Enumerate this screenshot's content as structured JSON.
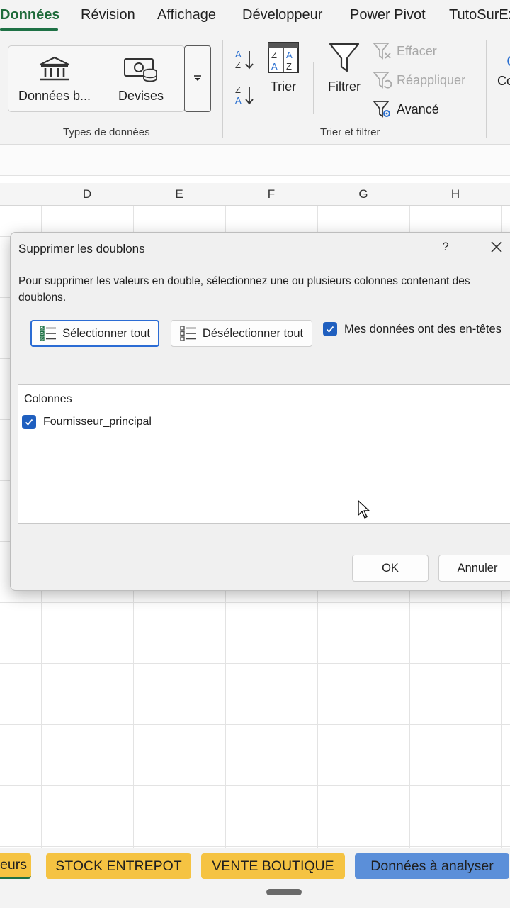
{
  "menu": {
    "tabs": [
      "Données",
      "Révision",
      "Affichage",
      "Développeur",
      "Power Pivot",
      "TutoSurExcel"
    ]
  },
  "ribbon": {
    "data_types": {
      "bank_label": "Données b...",
      "currency_label": "Devises",
      "group_label": "Types de données"
    },
    "sort_filter": {
      "sort_label": "Trier",
      "filter_label": "Filtrer",
      "clear_label": "Effacer",
      "reapply_label": "Réappliquer",
      "advanced_label": "Avancé",
      "group_label": "Trier et filtrer"
    },
    "cut_label": "Co"
  },
  "sheet": {
    "columns": [
      "D",
      "E",
      "F",
      "G",
      "H"
    ]
  },
  "dialog": {
    "title": "Supprimer les doublons",
    "help": "?",
    "description": "Pour supprimer les valeurs en double, sélectionnez une ou plusieurs colonnes contenant des doublons.",
    "select_all": "Sélectionner tout",
    "deselect_all": "Désélectionner tout",
    "headers_checkbox": "Mes données ont des en-têtes",
    "headers_checked": true,
    "columns_header": "Colonnes",
    "columns": [
      {
        "name": "Fournisseur_principal",
        "checked": true
      }
    ],
    "ok": "OK",
    "cancel": "Annuler"
  },
  "sheet_tabs": [
    {
      "label": "eurs",
      "color": "#f5c342"
    },
    {
      "label": "STOCK ENTREPOT",
      "color": "#f5c342"
    },
    {
      "label": "VENTE BOUTIQUE",
      "color": "#f5c342"
    },
    {
      "label": "Données à analyser",
      "color": "#5b8fd9"
    }
  ],
  "colors": {
    "accent_green": "#1e7145",
    "checkbox_blue": "#1f5fbf",
    "focus_blue": "#2b6cd4"
  }
}
